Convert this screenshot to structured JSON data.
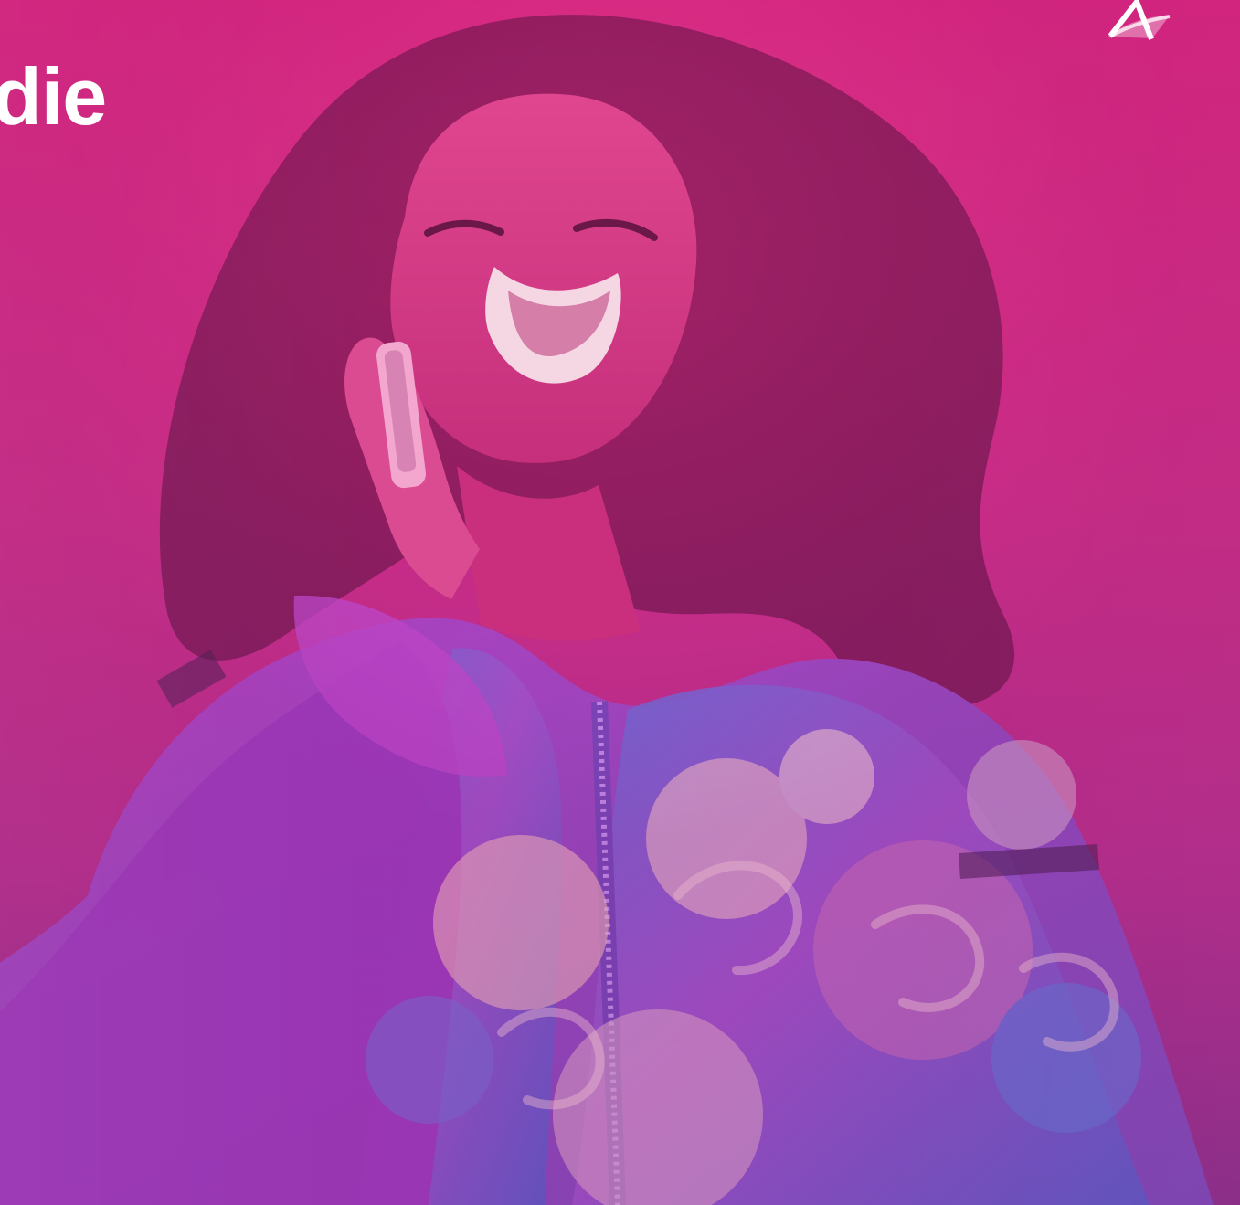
{
  "hero": {
    "headline": "die",
    "logo_icon": "brand-logo-icon",
    "photo_subject": "laughing-woman-phone-photo"
  },
  "colors": {
    "magenta": "#d9247f",
    "purple": "#8b2f8b",
    "white": "#ffffff",
    "overlay": "#c92c86"
  }
}
